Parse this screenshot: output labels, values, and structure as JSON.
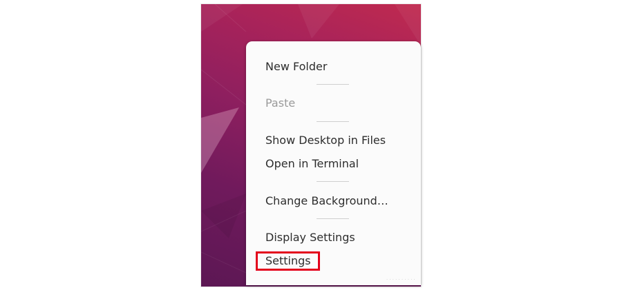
{
  "context_menu": {
    "items": [
      {
        "label": "New Folder",
        "enabled": true
      },
      {
        "label": "Paste",
        "enabled": false
      },
      {
        "label": "Show Desktop in Files",
        "enabled": true
      },
      {
        "label": "Open in Terminal",
        "enabled": true
      },
      {
        "label": "Change Background…",
        "enabled": true
      },
      {
        "label": "Display Settings",
        "enabled": true
      },
      {
        "label": "Settings",
        "enabled": true
      }
    ],
    "highlighted_item": "Settings"
  },
  "colors": {
    "highlight_border": "#e3001b",
    "menu_background": "#fbfbfb",
    "menu_text": "#2d2d2d",
    "disabled_text": "#9a9a9a",
    "wallpaper_top": "#c02a4f",
    "wallpaper_bottom": "#5c1754"
  }
}
